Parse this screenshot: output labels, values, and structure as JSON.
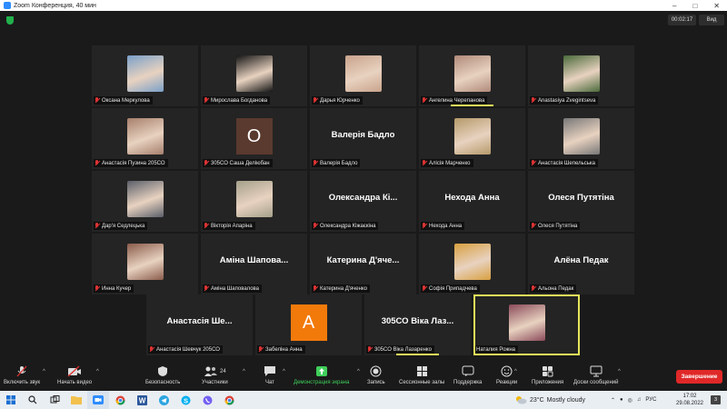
{
  "window": {
    "title": "Zoom Конференция, 40 мин"
  },
  "header": {
    "timer": "00:02:17",
    "view_label": "Вид"
  },
  "participants": [
    {
      "name": "Оксана Меркулова",
      "avatar": "#7aa0c8"
    },
    {
      "name": "Мирослава Богданова",
      "avatar": "#151515"
    },
    {
      "name": "Дарья Юрченко",
      "avatar": "#c9a38c"
    },
    {
      "name": "Ангелина Черепанова",
      "avatar": "#b08a7a"
    },
    {
      "name": "Anastasiya Zvegintseva",
      "avatar": "#4a6a3a"
    },
    {
      "name": "Анастасія Пузина 205СО",
      "avatar": "#a67f6c"
    },
    {
      "name": "305СО Саша Деліюбан",
      "letter": "О",
      "avatar": "#5a3a2e"
    },
    {
      "name": "Валерія Бадло",
      "bigname": "Валерія Бадло"
    },
    {
      "name": "Алісія Марченко",
      "avatar": "#b69a6a"
    },
    {
      "name": "Анастасія Шепельська",
      "avatar": "#777777"
    },
    {
      "name": "Дар'я Седлецька",
      "avatar": "#5a5f6a"
    },
    {
      "name": "Вікторія Апаріна",
      "avatar": "#a4a08a"
    },
    {
      "name": "Олександра Кіжаєкіна",
      "bigname": "Олександра Кі..."
    },
    {
      "name": "Нехода Анна",
      "bigname": "Нехода Анна"
    },
    {
      "name": "Олеся Путятіна",
      "bigname": "Олеся Путятіна"
    },
    {
      "name": "Инна Кучер",
      "avatar": "#8a5b4b"
    },
    {
      "name": "Аміна Шаповалова",
      "bigname": "Аміна Шапова..."
    },
    {
      "name": "Катерина Д'яченко",
      "bigname": "Катерина Д'яче..."
    },
    {
      "name": "Софія Припадчева",
      "avatar": "#d8a040"
    },
    {
      "name": "Альона Педак",
      "bigname": "Алёна Педак"
    },
    {
      "name": "Анастасія Шевчук 205СО",
      "bigname": "Анастасія Ше..."
    },
    {
      "name": "Забеліна Анна",
      "letter": "А",
      "avatar": "#f27a0b"
    },
    {
      "name": "305СО Віка Лазаренко",
      "bigname": "305СО Віка Лаз..."
    },
    {
      "name": "Наталия Рожна",
      "avatar": "#8a4a5a"
    }
  ],
  "toolbar": {
    "audio": "Включить звук",
    "video": "Начать видео",
    "security": "Безопасность",
    "participants": "Участники",
    "participants_count": "24",
    "chat": "Чат",
    "share": "Демонстрация экрана",
    "record": "Запись",
    "breakout": "Сессионные залы",
    "support": "Поддержка",
    "reactions": "Реакции",
    "apps": "Приложения",
    "whiteboard": "Доски сообщений",
    "end": "Завершение"
  },
  "taskbar": {
    "temperature": "23°C",
    "weather": "Mostly cloudy",
    "lang": "РУС",
    "time": "17:02",
    "date": "29.08.2022",
    "notifications": "3"
  },
  "colors": {
    "speaker": "#e6e65a",
    "share": "#3fcf5a",
    "end": "#e02828"
  }
}
